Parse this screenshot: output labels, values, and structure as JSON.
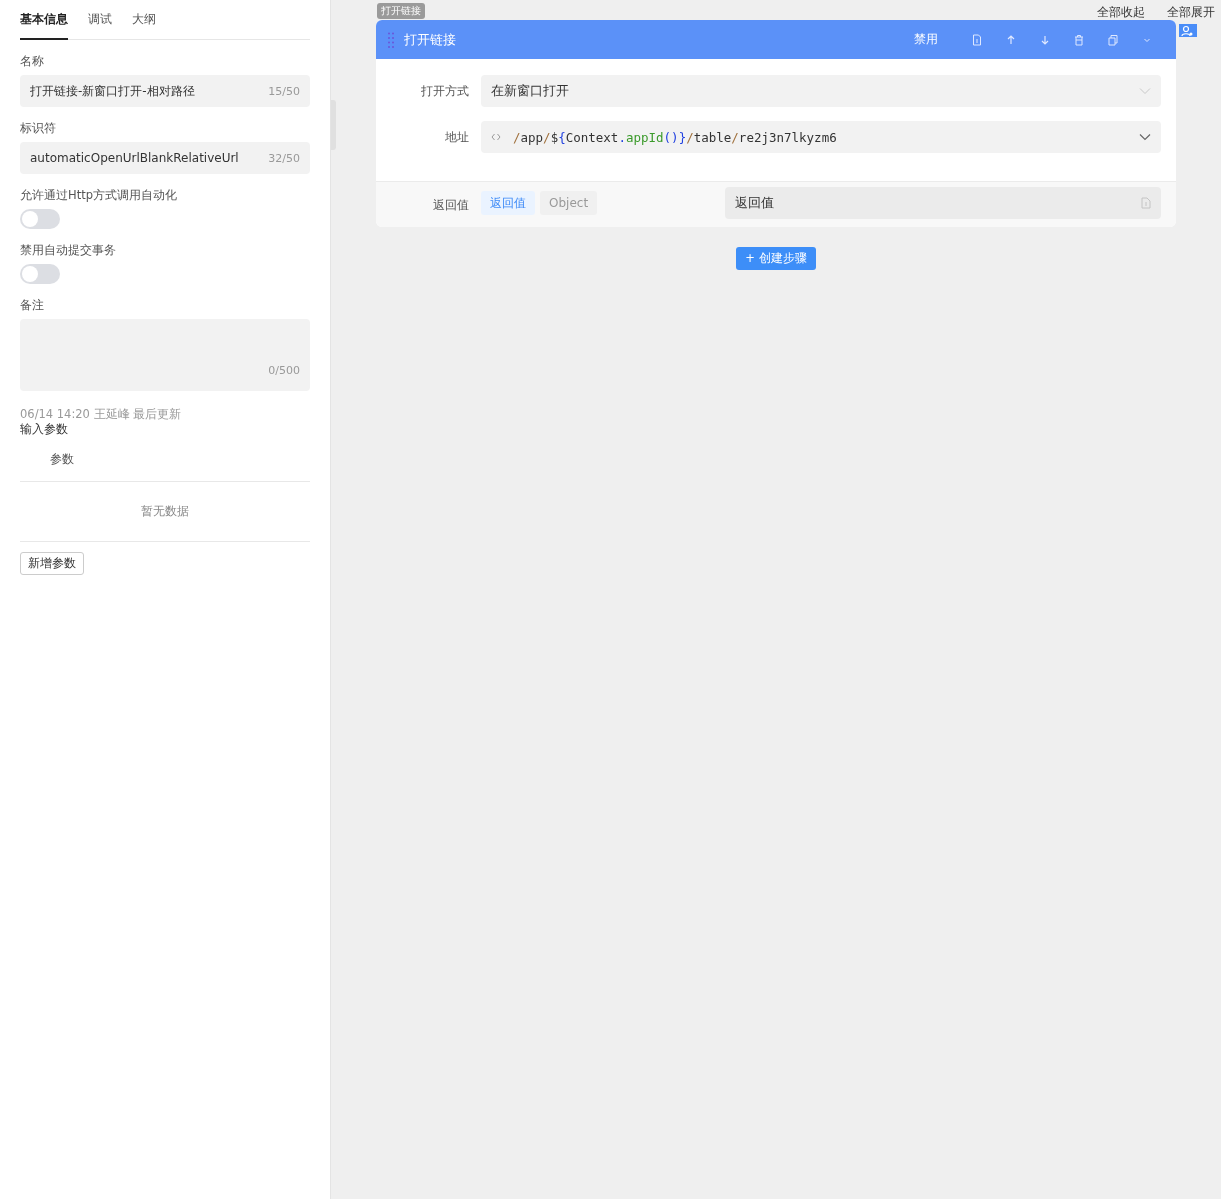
{
  "sidebar": {
    "tabs": [
      {
        "label": "基本信息",
        "selected": true
      },
      {
        "label": "调试",
        "selected": false
      },
      {
        "label": "大纲",
        "selected": false
      }
    ],
    "fields": [
      {
        "label": "名称",
        "value": "打开链接-新窗口打开-相对路径",
        "count": "15/50"
      },
      {
        "label": "标识符",
        "value": "automaticOpenUrlBlankRelativeUrl",
        "count": "32/50"
      }
    ],
    "switches": [
      {
        "label": "允许通过Http方式调用自动化",
        "on": false
      },
      {
        "label": "禁用自动提交事务",
        "on": false
      }
    ],
    "note": {
      "label": "备注",
      "count": "0/500"
    },
    "updated": "06/14 14:20 王延峰 最后更新",
    "params": {
      "title": "输入参数",
      "column": "参数",
      "empty": "暂无数据",
      "add_button": "新增参数"
    }
  },
  "toolbar": {
    "collapse_all": "全部收起",
    "expand_all": "全部展开"
  },
  "step": {
    "tag": "打开链接",
    "title": "打开链接",
    "disable": "禁用",
    "open_mode": {
      "label": "打开方式",
      "value": "在新窗口打开"
    },
    "url": {
      "label": "地址",
      "tokens": [
        {
          "text": "/",
          "kind": "slash"
        },
        {
          "text": "app",
          "kind": "plain"
        },
        {
          "text": "/",
          "kind": "slash"
        },
        {
          "text": "$",
          "kind": "plain"
        },
        {
          "text": "{",
          "kind": "brace"
        },
        {
          "text": "Context",
          "kind": "plain"
        },
        {
          "text": ".",
          "kind": "brace"
        },
        {
          "text": "appId",
          "kind": "func"
        },
        {
          "text": "()",
          "kind": "brace"
        },
        {
          "text": "}",
          "kind": "brace"
        },
        {
          "text": "/",
          "kind": "slash"
        },
        {
          "text": "table",
          "kind": "plain"
        },
        {
          "text": "/",
          "kind": "slash"
        },
        {
          "text": "re2j3n7lkyzm6",
          "kind": "plain"
        }
      ]
    },
    "return": {
      "label": "返回值",
      "options": [
        {
          "label": "返回值",
          "selected": true
        },
        {
          "label": "Object",
          "selected": false
        }
      ],
      "value": "返回值"
    }
  },
  "create_button": "+ 创建步骤"
}
